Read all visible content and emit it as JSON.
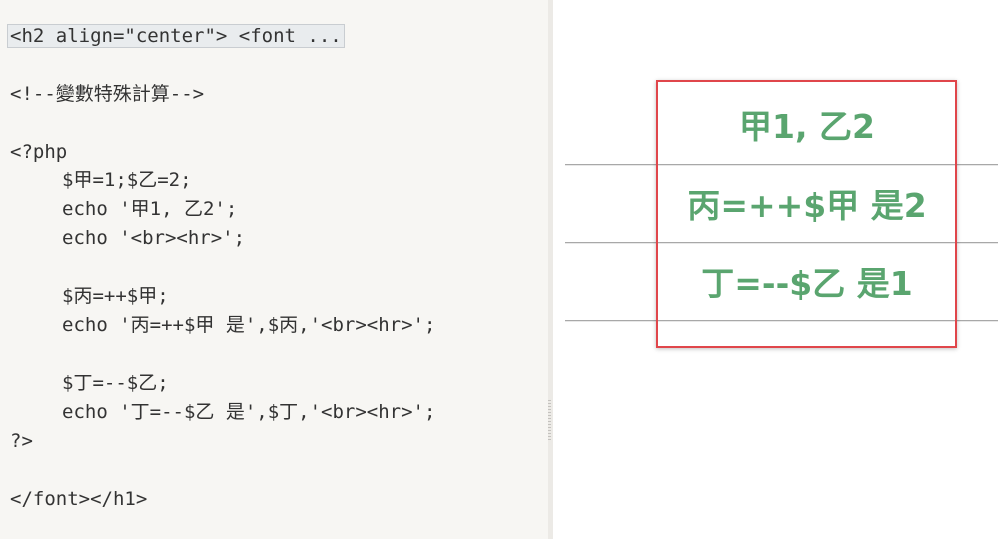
{
  "editor": {
    "lines": {
      "collapsed_h2": "<h2 align=\"center\"> <font ...",
      "comment": "<!--變數特殊計算-->",
      "php_open": "<?php",
      "assign_vars": "$甲=1;$乙=2;",
      "echo_first": "echo '甲1, 乙2';",
      "echo_br_hr": "echo '<br><hr>';",
      "pre_increment": "$丙=++$甲;",
      "echo_increment": "echo '丙=++$甲 是',$丙,'<br><hr>';",
      "pre_decrement": "$丁=--$乙;",
      "echo_decrement": "echo '丁=--$乙 是',$丁,'<br><hr>';",
      "php_close": "?>",
      "close_tags": "</font></h1>"
    }
  },
  "preview": {
    "output_lines": [
      "甲1, 乙2",
      "丙=++$甲 是2",
      "丁=--$乙 是1"
    ],
    "text_color": "#5aa56f",
    "highlight_color": "#e0464b"
  }
}
